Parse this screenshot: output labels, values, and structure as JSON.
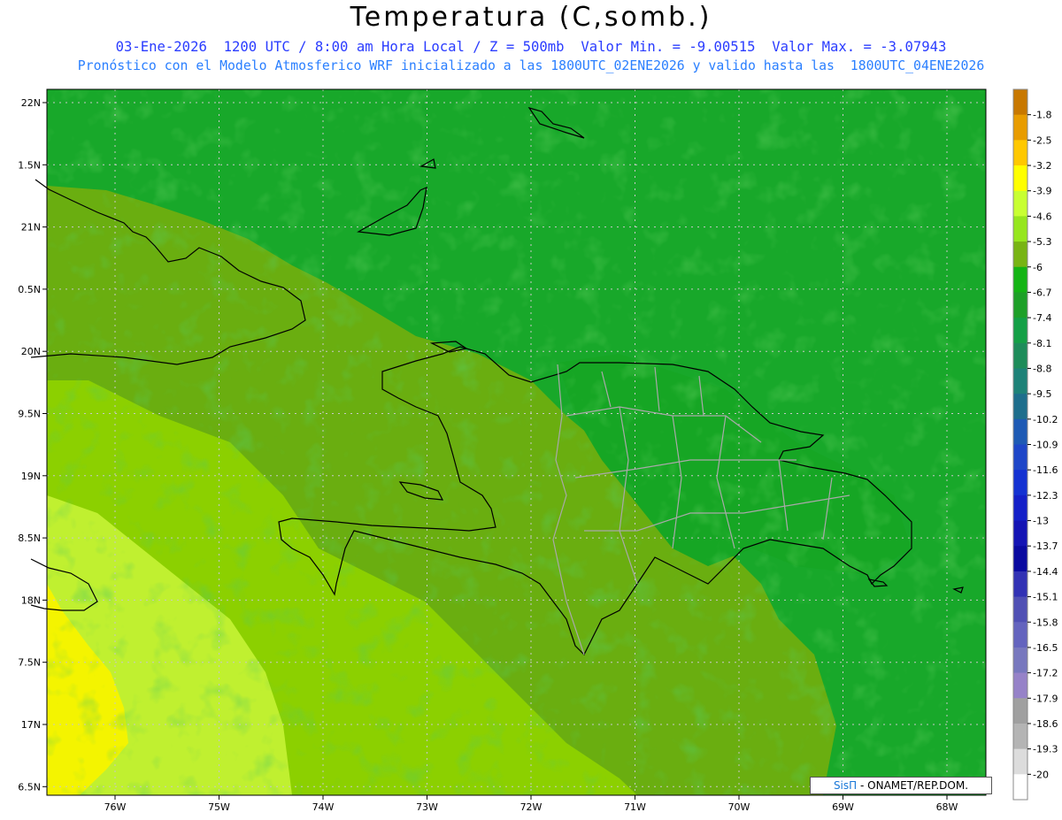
{
  "header": {
    "title": "Temperatura (C,somb.)",
    "line1": "03-Ene-2026  1200 UTC / 8:00 am Hora Local / Z = 500mb  Valor Min. = -9.00515  Valor Max. = -3.07943",
    "line2": "Pronóstico con el Modelo Atmosferico WRF inicializado a las 1800UTC_02ENE2026 y valido hasta las  1800UTC_04ENE2026"
  },
  "axes": {
    "lat_labels": [
      "22N",
      "1.5N",
      "21N",
      "0.5N",
      "20N",
      "9.5N",
      "19N",
      "8.5N",
      "18N",
      "7.5N",
      "17N",
      "6.5N"
    ],
    "lon_labels": [
      "76W",
      "75W",
      "74W",
      "73W",
      "72W",
      "71W",
      "70W",
      "69W",
      "68W"
    ]
  },
  "colorbar": {
    "labels": [
      "-1.8",
      "-2.5",
      "-3.2",
      "-3.9",
      "-4.6",
      "-5.3",
      "-6",
      "-6.7",
      "-7.4",
      "-8.1",
      "-8.8",
      "-9.5",
      "-10.2",
      "-10.9",
      "-11.6",
      "-12.3",
      "-13",
      "-13.7",
      "-14.4",
      "-15.1",
      "-15.8",
      "-16.5",
      "-17.2",
      "-17.9",
      "-18.6",
      "-19.3",
      "-20"
    ],
    "colors": [
      "#c87800",
      "#e89c00",
      "#ffc800",
      "#ffff00",
      "#c8ff32",
      "#96e61e",
      "#78b414",
      "#14b414",
      "#1ea028",
      "#14a046",
      "#1e8c5a",
      "#1e8278",
      "#1e6e8c",
      "#1e5ab4",
      "#1e46c8",
      "#1432d2",
      "#1420c8",
      "#1414b4",
      "#0a0aa0",
      "#3232b4",
      "#5050b4",
      "#6464be",
      "#7878be",
      "#9682c8",
      "#a0a0a0",
      "#b4b4b4",
      "#dcdcdc",
      "#ffffff"
    ]
  },
  "field_colors": {
    "ocean_north": "#18a82a",
    "ocean_mid": "#6aae10",
    "warm": "#8cd000",
    "warmer": "#c0f030",
    "warmest": "#f4f400",
    "dr_east": "#16a624"
  },
  "credit": {
    "brand": "SisΠ",
    "text": "- ONAMET/REP.DOM."
  }
}
